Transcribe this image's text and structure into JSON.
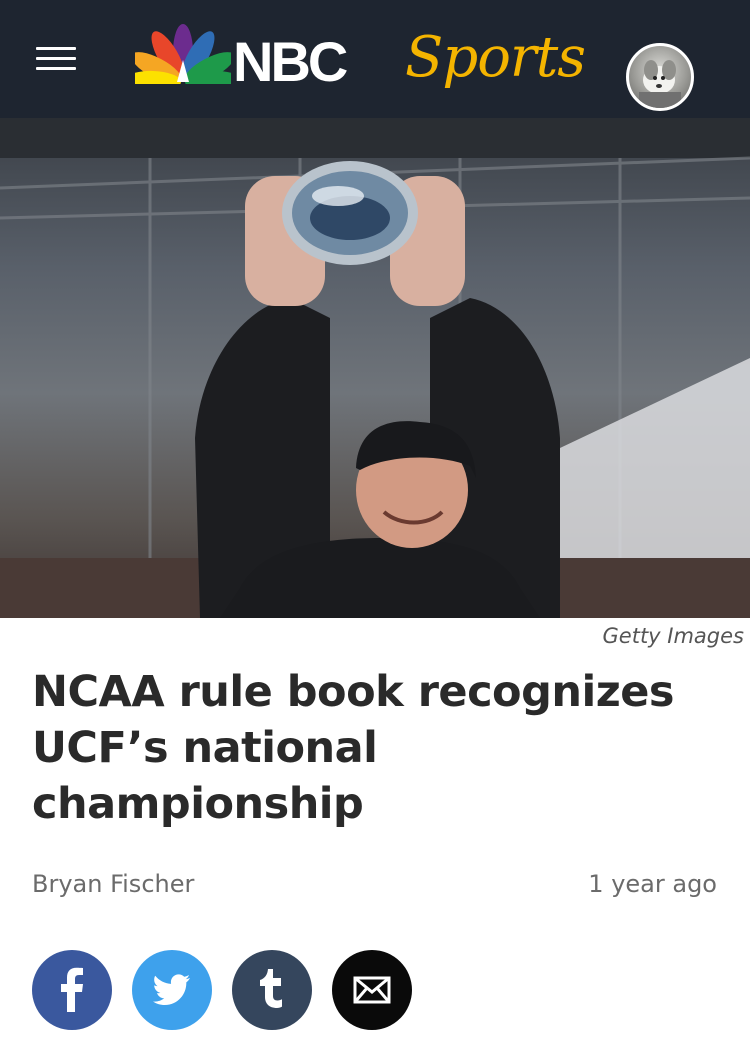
{
  "header": {
    "logo_text_nbc": "NBC",
    "logo_text_sports": "Sports",
    "menu_icon": "hamburger-menu-icon",
    "avatar_icon": "user-avatar-icon",
    "colors": {
      "bar": "#1e2530",
      "sports_gold": "#f4b400"
    }
  },
  "article": {
    "photo_credit": "Getty Images",
    "headline": "NCAA rule book recognizes UCF’s national championship",
    "author": "Bryan Fischer",
    "time": "1 year ago"
  },
  "share": {
    "buttons": [
      {
        "icon": "facebook-icon",
        "color": "#3a589e"
      },
      {
        "icon": "twitter-icon",
        "color": "#3ea1ec"
      },
      {
        "icon": "tumblr-icon",
        "color": "#35465d"
      },
      {
        "icon": "email-icon",
        "color": "#0a0a0a"
      }
    ]
  }
}
